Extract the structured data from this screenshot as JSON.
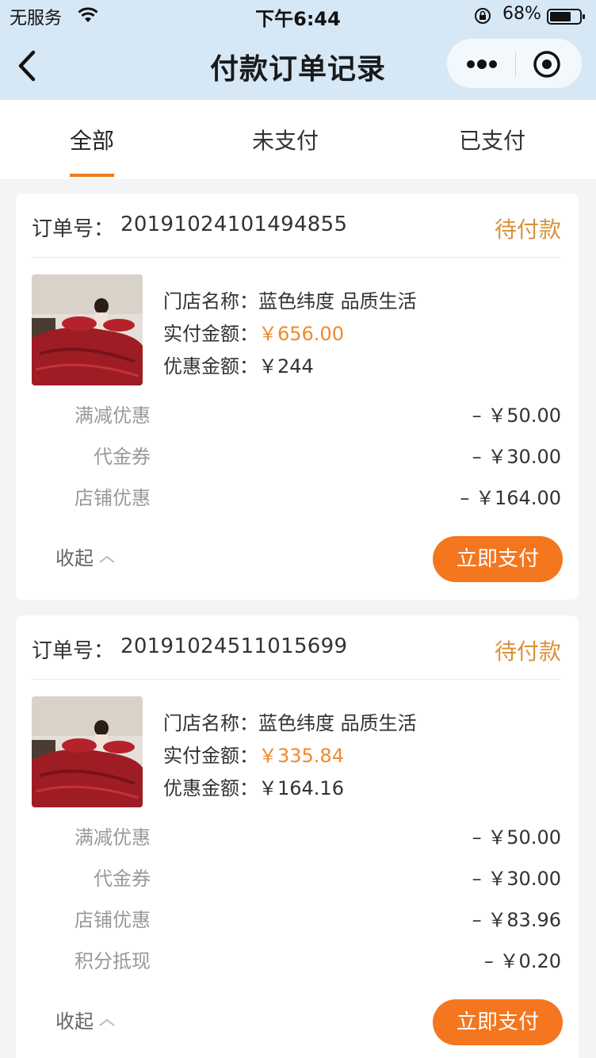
{
  "status_bar": {
    "carrier": "无服务",
    "time": "下午6:44",
    "battery": "68%"
  },
  "nav": {
    "title": "付款订单记录"
  },
  "tabs": [
    {
      "label": "全部",
      "active": true
    },
    {
      "label": "未支付",
      "active": false
    },
    {
      "label": "已支付",
      "active": false
    }
  ],
  "labels": {
    "order_no": "订单号：",
    "store": "门店名称：",
    "paid": "实付金额：",
    "discount": "优惠金额：",
    "collapse": "收起",
    "pay_button": "立即支付"
  },
  "orders": [
    {
      "order_no": "20191024101494855",
      "status": "待付款",
      "store": "蓝色纬度 品质生活",
      "paid": "￥656.00",
      "discount": "￥244",
      "discounts": [
        {
          "label": "满减优惠",
          "value": "– ￥50.00"
        },
        {
          "label": "代金券",
          "value": "– ￥30.00"
        },
        {
          "label": "店铺优惠",
          "value": "– ￥164.00"
        }
      ]
    },
    {
      "order_no": "20191024511015699",
      "status": "待付款",
      "store": "蓝色纬度 品质生活",
      "paid": "￥335.84",
      "discount": "￥164.16",
      "discounts": [
        {
          "label": "满减优惠",
          "value": "– ￥50.00"
        },
        {
          "label": "代金券",
          "value": "– ￥30.00"
        },
        {
          "label": "店铺优惠",
          "value": "– ￥83.96"
        },
        {
          "label": "积分抵现",
          "value": "– ￥0.20"
        }
      ]
    }
  ],
  "colors": {
    "accent": "#f4761f",
    "status": "#d8913c",
    "header_bg": "#d6e7f5"
  }
}
